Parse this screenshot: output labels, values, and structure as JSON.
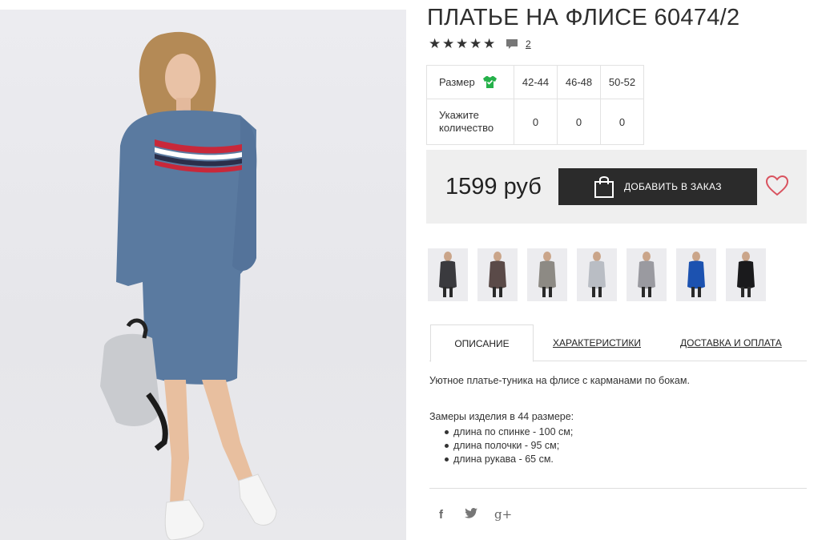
{
  "product": {
    "title": "ПЛАТЬЕ НА ФЛИСЕ 60474/2",
    "rating_stars": 5,
    "review_count": "2",
    "price": "1599 руб"
  },
  "size_table": {
    "size_label": "Размер",
    "quantity_label": "Укажите количество",
    "sizes": [
      "42-44",
      "46-48",
      "50-52"
    ],
    "quantities": [
      "0",
      "0",
      "0"
    ]
  },
  "actions": {
    "add_to_order": "ДОБАВИТЬ В ЗАКАЗ"
  },
  "thumbnails": [
    {
      "color": "#3a3a3e",
      "name": "thumb-charcoal-dress"
    },
    {
      "color": "#5a4a48",
      "name": "thumb-brown-dress"
    },
    {
      "color": "#8d8a84",
      "name": "thumb-grey-stripe-dress"
    },
    {
      "color": "#b9bdc4",
      "name": "thumb-light-grey-dress"
    },
    {
      "color": "#9a9aa0",
      "name": "thumb-grey-dress"
    },
    {
      "color": "#1c52b0",
      "name": "thumb-blue-dress"
    },
    {
      "color": "#1a1a1c",
      "name": "thumb-black-dress"
    }
  ],
  "tabs": [
    "ОПИСАНИЕ",
    "ХАРАКТЕРИСТИКИ",
    "ДОСТАВКА И ОПЛАТА"
  ],
  "description": {
    "text": "Уютное платье-туника на флисе с карманами по бокам.",
    "measures_title": "Замеры изделия в 44 размере:",
    "measures": [
      "длина по спинке - 100 см;",
      "длина полочки - 95 см;",
      "длина рукава - 65 см."
    ]
  },
  "social": {
    "facebook": "f",
    "twitter": "🐦",
    "googleplus": "g+"
  },
  "colors": {
    "button": "#2b2b2b",
    "heart": "#d9535f",
    "shirt_icon": "#25b14a",
    "dress": "#5a7aa0"
  }
}
